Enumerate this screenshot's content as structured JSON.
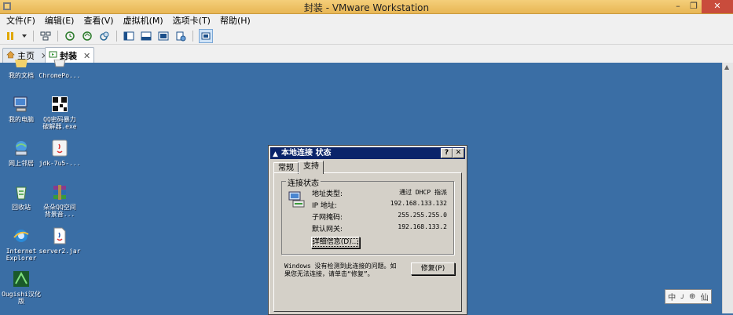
{
  "window": {
    "title": "封装 - VMware Workstation",
    "minimize": "–",
    "restore": "❐",
    "close": "✕"
  },
  "menu": [
    "文件(F)",
    "编辑(E)",
    "查看(V)",
    "虚拟机(M)",
    "选项卡(T)",
    "帮助(H)"
  ],
  "toolbar_icons": [
    "pause-icon",
    "dropdown-arrow-icon",
    "network-icon",
    "snapshot-icon",
    "revert-snapshot-icon",
    "snapshot-manager-icon",
    "console-view-icon",
    "unity-icon",
    "fullscreen-icon",
    "preferences-icon",
    "thumbnail-view-icon"
  ],
  "tabs": [
    {
      "label": "主页",
      "icon": "home-icon"
    },
    {
      "label": "封装",
      "icon": "vm-icon"
    }
  ],
  "desktop": {
    "icons": [
      {
        "label": "我的文档",
        "icon": "my-documents-icon"
      },
      {
        "label": "ChromePo...",
        "icon": "chrome-portable-icon"
      },
      {
        "label": "我的电脑",
        "icon": "my-computer-icon"
      },
      {
        "label": "QQ密码暴力\n破解器.exe",
        "icon": "qq-cracker-icon"
      },
      {
        "label": "网上邻居",
        "icon": "network-places-icon"
      },
      {
        "label": "jdk-7u5-...",
        "icon": "jdk-installer-icon"
      },
      {
        "label": "回收站",
        "icon": "recycle-bin-icon"
      },
      {
        "label": "朵朵QQ空间\n背景音...",
        "icon": "winrar-archive-icon"
      },
      {
        "label": "Internet\nExplorer",
        "icon": "internet-explorer-icon"
      },
      {
        "label": "server2.jar",
        "icon": "jar-file-icon"
      },
      {
        "label": "Ougishi汉化\n版",
        "icon": "ougishi-app-icon"
      }
    ]
  },
  "dialog": {
    "title": "本地连接 状态",
    "help_btn": "?",
    "close_btn": "✕",
    "tabs": [
      "常规",
      "支持"
    ],
    "group_title": "连接状态",
    "rows": [
      {
        "key": "地址类型:",
        "value": "通过 DHCP 指派"
      },
      {
        "key": "IP 地址:",
        "value": "192.168.133.132"
      },
      {
        "key": "子网掩码:",
        "value": "255.255.255.0"
      },
      {
        "key": "默认网关:",
        "value": "192.168.133.2"
      }
    ],
    "details_button": "详细信息(D)...",
    "message": "Windows 没有检测到此连接的问题。如果您无法连接，请单击“修复”。",
    "repair_button": "修复(P)"
  },
  "ime": {
    "items": [
      "中",
      "ᴊ",
      "⊕",
      "仙"
    ]
  }
}
